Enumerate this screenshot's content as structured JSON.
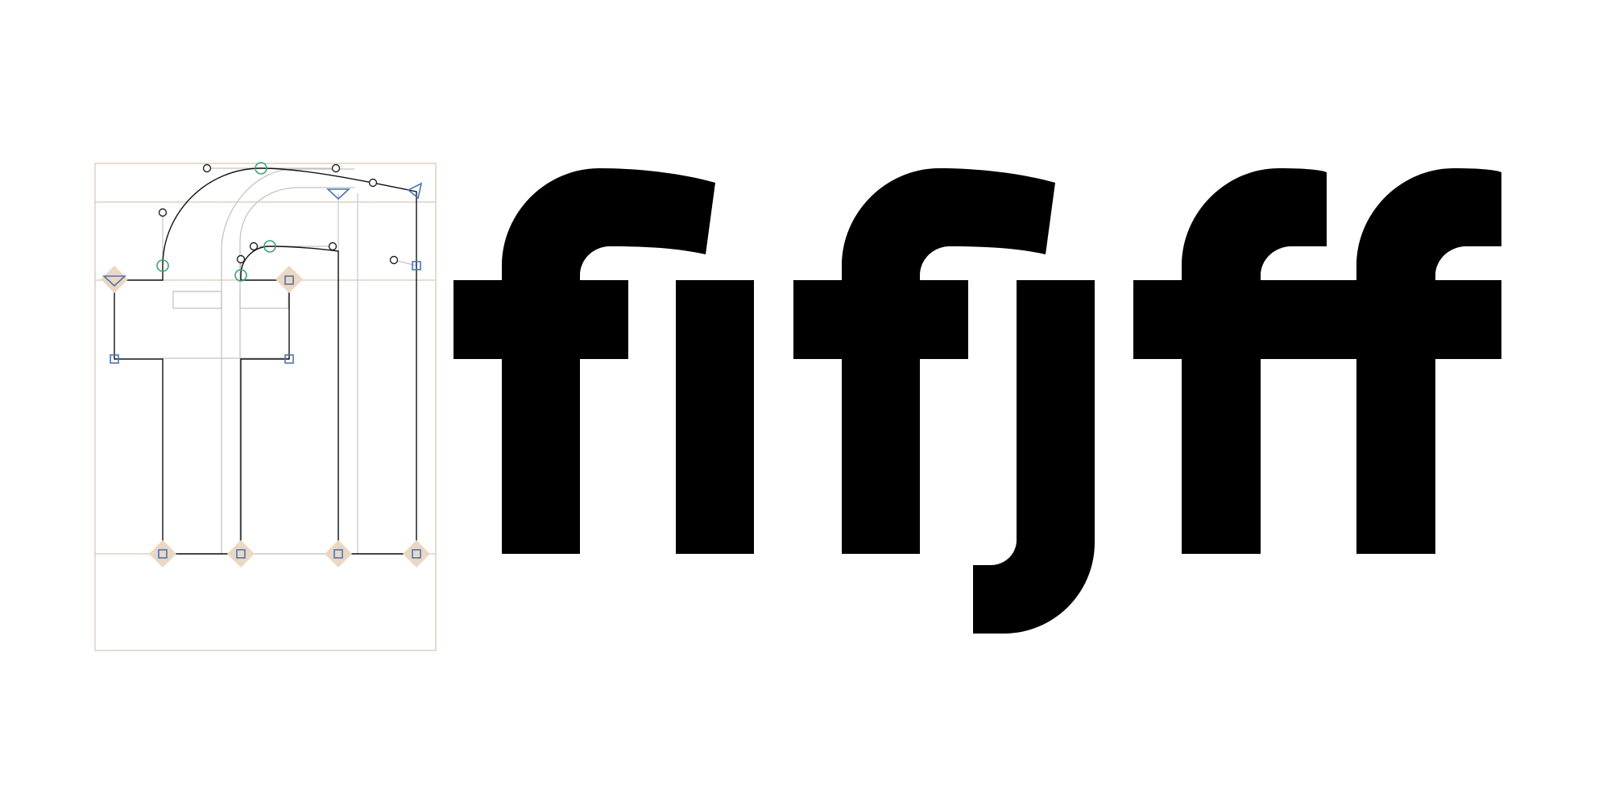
{
  "canvas": {
    "background": "#ffffff"
  },
  "editor": {
    "glyph_name": "",
    "frame_color": "#d8c8b8",
    "outline_color": "#111111",
    "ghost_color": "#c4c4c4",
    "smooth_point_color": "#3aa374",
    "corner_point_color": "#4c74b4",
    "anchor_color": "#ecd7c2",
    "offcurve_color": "#222222"
  },
  "preview": {
    "text": "fifjff",
    "fill_color": "#000000",
    "glyphs": [
      "f",
      "i",
      "f",
      "j",
      "f",
      "f"
    ]
  },
  "icons": {
    "start_point": "triangle-arrow-icon",
    "smooth_point": "circle-node-icon",
    "corner_point": "square-node-icon",
    "anchor": "diamond-anchor-icon"
  }
}
